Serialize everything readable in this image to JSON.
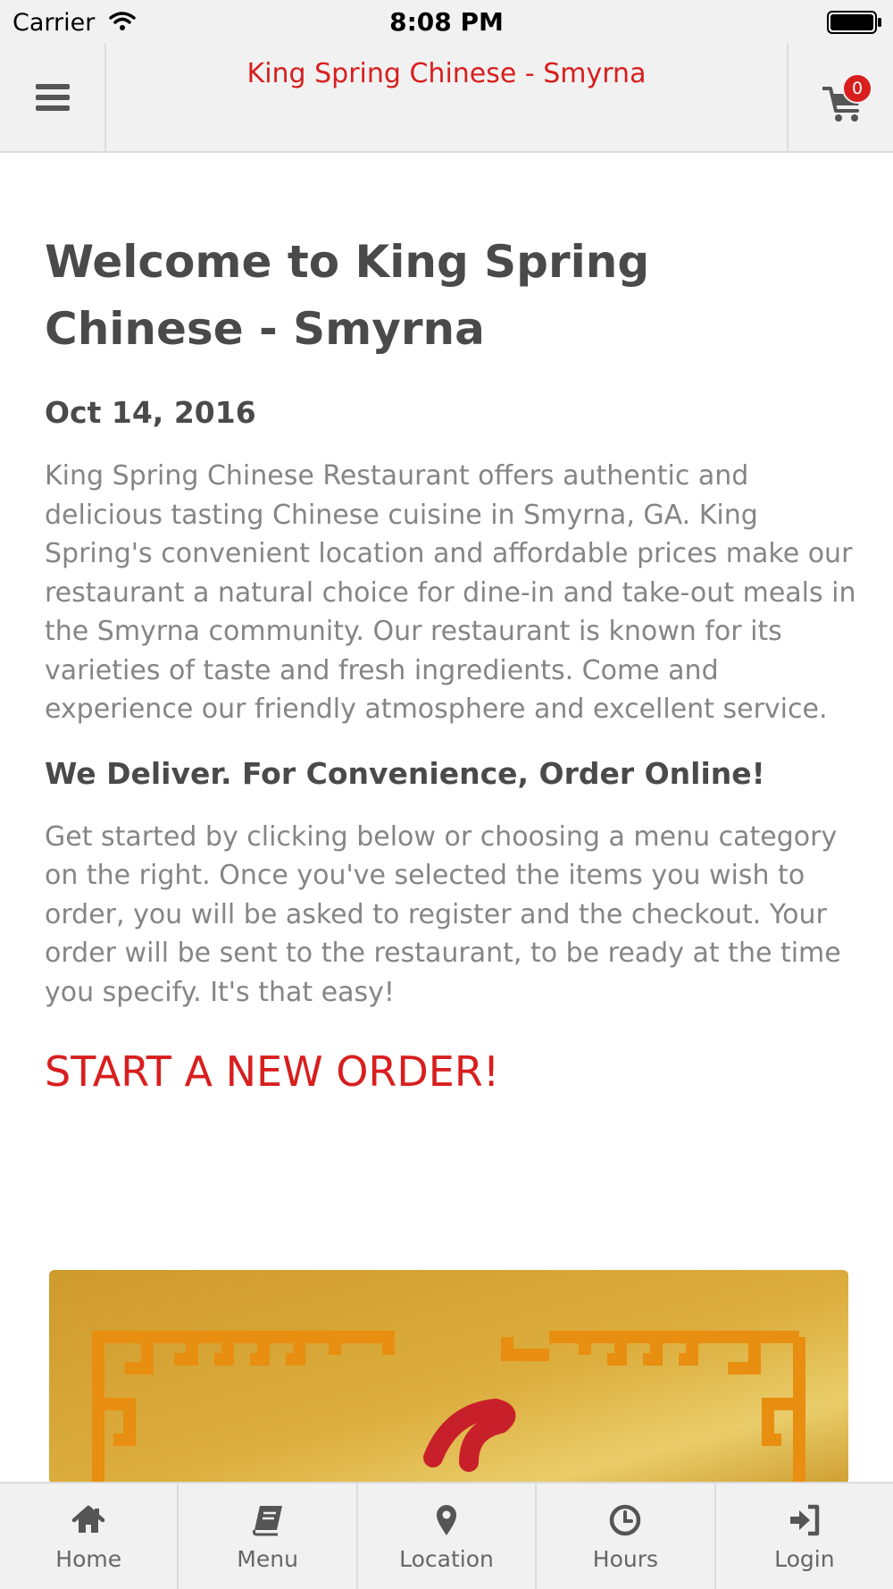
{
  "status_bar": {
    "carrier": "Carrier",
    "time": "8:08 PM"
  },
  "nav": {
    "title": "King Spring Chinese - Smyrna",
    "cart_count": "0",
    "menu_icon": "hamburger-icon",
    "cart_icon": "shopping-cart-icon"
  },
  "content": {
    "heading": "Welcome to King Spring Chinese - Smyrna",
    "date": "Oct 14, 2016",
    "intro": "King Spring Chinese Restaurant offers authentic and delicious tasting Chinese cuisine in Smyrna, GA. King Spring's convenient location and affordable prices make our restaurant a natural choice for dine-in and take-out meals in the Smyrna community. Our restaurant is known for its varieties of taste and fresh ingredients. Come and experience our friendly atmosphere and excellent service.",
    "subheading": "We Deliver. For Convenience, Order Online!",
    "instructions": "Get started by clicking below or choosing a menu category on the right. Once you've selected the items you wish to order, you will be asked to register and the checkout. Your order will be sent to the restaurant, to be ready at the time you specify. It's that easy!",
    "cta": "START A NEW ORDER!"
  },
  "tabs": [
    {
      "label": "Home",
      "icon": "home-icon"
    },
    {
      "label": "Menu",
      "icon": "book-icon"
    },
    {
      "label": "Location",
      "icon": "map-marker-icon"
    },
    {
      "label": "Hours",
      "icon": "clock-icon"
    },
    {
      "label": "Login",
      "icon": "sign-in-icon"
    }
  ],
  "colors": {
    "accent": "#d81e1e",
    "heading_text": "#4a4a4a",
    "body_text": "#858585",
    "bar_background": "#f1f1f1"
  }
}
